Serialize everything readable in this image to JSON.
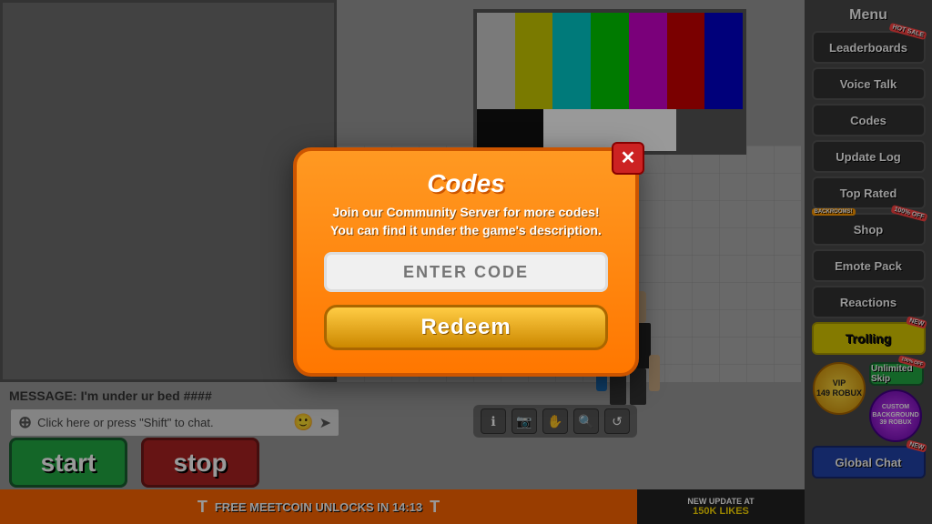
{
  "menu": {
    "title": "Menu",
    "buttons": [
      {
        "label": "Leaderboards",
        "id": "leaderboards",
        "badge": "HOT SALE",
        "badgeType": "hot"
      },
      {
        "label": "Voice Talk",
        "id": "voice-talk",
        "badge": null
      },
      {
        "label": "Codes",
        "id": "codes",
        "badge": null
      },
      {
        "label": "Update Log",
        "id": "update-log",
        "badge": null
      },
      {
        "label": "Top Rated",
        "id": "top-rated",
        "badge": null
      },
      {
        "label": "Shop",
        "id": "shop",
        "badge": "BACKROOMS!",
        "badgeType": "backrooms",
        "badge2": "100% OFF",
        "badge2Type": "hot"
      },
      {
        "label": "Emote Pack",
        "id": "emote-pack",
        "badge": null
      },
      {
        "label": "Reactions",
        "id": "reactions",
        "badge": null
      },
      {
        "label": "Trolling",
        "id": "trolling",
        "style": "yellow",
        "badge": "NEW",
        "badgeType": "new"
      },
      {
        "label": "Unlimited Skip",
        "id": "unlimited-skip",
        "style": "green",
        "badge": "100% OFF",
        "badgeType": "hot"
      },
      {
        "label": "Global Chat",
        "id": "global-chat",
        "style": "blue",
        "badge": "NEW",
        "badgeType": "new"
      }
    ],
    "vip": {
      "label": "VIP",
      "price": "149 ROBUX"
    },
    "custom": {
      "label": "CUSTOM BACKGROUND",
      "price": "39 ROBUX"
    }
  },
  "modal": {
    "title": "Codes",
    "subtitle": "Join our Community Server for more codes!\nYou can find it under the game's description.",
    "input_placeholder": "ENTER CODE",
    "redeem_label": "Redeem",
    "close_label": "✕"
  },
  "chat": {
    "message_label": "MESSAGE:",
    "message_text": "I'm under ur bed ####",
    "chat_placeholder": "Click here or press \"Shift\" to chat.",
    "plus_icon": "⊕"
  },
  "buttons": {
    "start_label": "start",
    "stop_label": "stop"
  },
  "ticker": {
    "icon_left": "T",
    "text": "FREE MEETCOIN UNLOCKS IN 14:13",
    "icon_right": "T"
  },
  "update_bar": {
    "text": "NEW UPDATE AT",
    "likes": "150K LIKES"
  },
  "likes_bar": {
    "percent": "85%"
  },
  "char_controls": [
    {
      "icon": "ℹ",
      "id": "info"
    },
    {
      "icon": "📷",
      "id": "camera"
    },
    {
      "icon": "✋",
      "id": "hand"
    },
    {
      "icon": "🔍",
      "id": "search"
    },
    {
      "icon": "↺",
      "id": "refresh"
    }
  ]
}
